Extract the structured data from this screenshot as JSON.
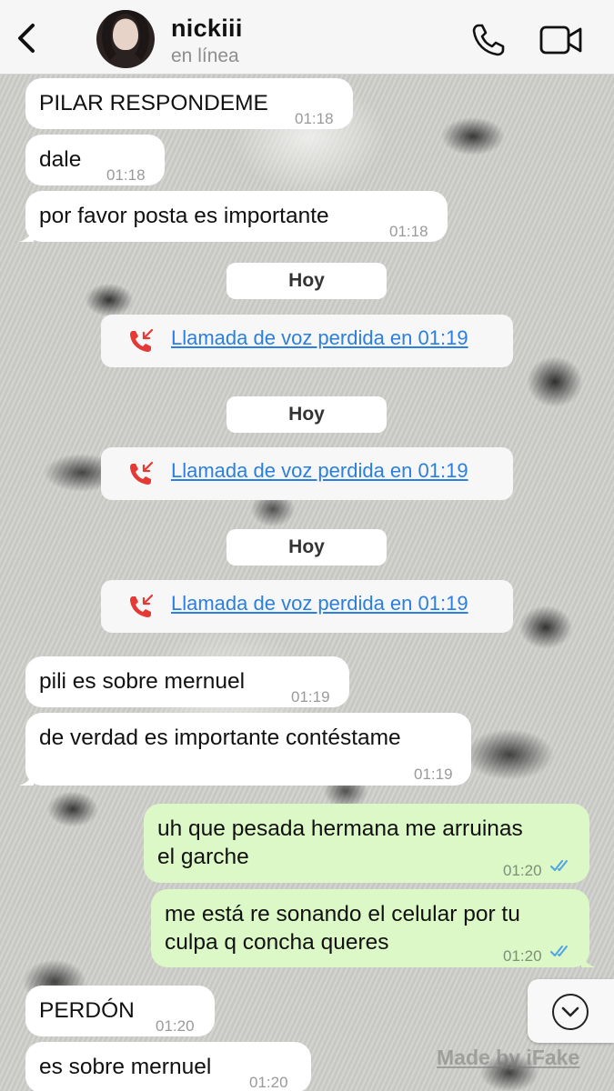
{
  "header": {
    "contact_name": "nickiii",
    "status": "en línea"
  },
  "messages": [
    {
      "direction": "in",
      "text": "PILAR RESPONDEME",
      "time": "01:18"
    },
    {
      "direction": "in",
      "text": "dale",
      "time": "01:18"
    },
    {
      "direction": "in",
      "text": "por favor posta es importante",
      "time": "01:18"
    },
    {
      "direction": "system",
      "day": "Hoy",
      "missed_call": "Llamada de voz perdida en 01:19"
    },
    {
      "direction": "system",
      "day": "Hoy",
      "missed_call": "Llamada de voz perdida en 01:19"
    },
    {
      "direction": "system",
      "day": "Hoy",
      "missed_call": "Llamada de voz perdida en 01:19"
    },
    {
      "direction": "in",
      "text": "pili es sobre mernuel",
      "time": "01:19"
    },
    {
      "direction": "in",
      "text": "de verdad es importante contéstame",
      "time": "01:19"
    },
    {
      "direction": "out",
      "lines": [
        "uh que pesada hermana me arruinas",
        "el garche"
      ],
      "time": "01:20",
      "read": true
    },
    {
      "direction": "out",
      "lines": [
        "me está re sonando el celular por tu",
        "culpa q concha queres"
      ],
      "time": "01:20",
      "read": true
    },
    {
      "direction": "in",
      "text": "PERDÓN",
      "time": "01:20"
    },
    {
      "direction": "in",
      "text": "es sobre mernuel",
      "time": "01:20"
    }
  ],
  "watermark": "Made by iFake",
  "colors": {
    "incoming_bubble": "#ffffff",
    "outgoing_bubble": "#dcf8c6",
    "read_ticks": "#4fa3e6",
    "missed_call_icon": "#e53935",
    "missed_call_text": "#2a7fe0"
  },
  "icons": {
    "back": "chevron-left-icon",
    "call": "phone-icon",
    "video": "video-camera-icon",
    "missed_call": "missed-call-icon",
    "scroll": "chevron-down-icon"
  }
}
